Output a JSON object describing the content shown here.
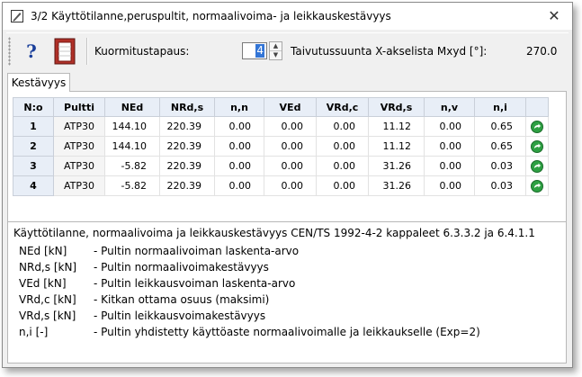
{
  "window": {
    "title": "3/2  Käyttötilanne,peruspultit, normaalivoima- ja leikkauskestävyys",
    "close_glyph": "✕"
  },
  "toolbar": {
    "help_label": "?",
    "load_case_label": "Kuormitustapaus:",
    "load_case_value": "4",
    "bending_label": "Taivutussuunta X-akselista Mxyd [°]:",
    "bending_value": "270.0"
  },
  "tabs": [
    {
      "label": "Kestävyys"
    }
  ],
  "table": {
    "columns": [
      "N:o",
      "Pultti",
      "NEd",
      "NRd,s",
      "n,n",
      "VEd",
      "VRd,c",
      "VRd,s",
      "n,v",
      "n,i",
      ""
    ],
    "rows": [
      [
        "1",
        "ATP30",
        "144.10",
        "220.39",
        "0.00",
        "0.00",
        "0.00",
        "11.12",
        "0.00",
        "0.65"
      ],
      [
        "2",
        "ATP30",
        "144.10",
        "220.39",
        "0.00",
        "0.00",
        "0.00",
        "11.12",
        "0.00",
        "0.65"
      ],
      [
        "3",
        "ATP30",
        "-5.82",
        "220.39",
        "0.00",
        "0.00",
        "0.00",
        "31.26",
        "0.00",
        "0.03"
      ],
      [
        "4",
        "ATP30",
        "-5.82",
        "220.39",
        "0.00",
        "0.00",
        "0.00",
        "31.26",
        "0.00",
        "0.03"
      ]
    ]
  },
  "info": {
    "title": "Käyttötilanne, normaalivoima ja leikkauskestävyys CEN/TS 1992-4-2 kappaleet 6.3.3.2 ja 6.4.1.1",
    "legend": [
      {
        "symbol": "NEd [kN]",
        "desc": "- Pultin normaalivoiman laskenta-arvo"
      },
      {
        "symbol": "NRd,s [kN]",
        "desc": "- Pultin normaalivoimakestävyys"
      },
      {
        "symbol": "VEd [kN]",
        "desc": "- Pultin leikkausvoiman laskenta-arvo"
      },
      {
        "symbol": "VRd,c [kN]",
        "desc": "- Kitkan ottama osuus (maksimi)"
      },
      {
        "symbol": "VRd,s [kN]",
        "desc": "- Pultin leikkausvoimakestävyys"
      },
      {
        "symbol": "n,i [-]",
        "desc": "- Pultin yhdistetty käyttöaste normaalivoimalle ja leikkaukselle (Exp=2)"
      }
    ]
  },
  "colors": {
    "header_bg": "#e8eef7",
    "ok_icon": "#2ea043",
    "selection": "#3375d6"
  },
  "icons": {
    "title": "pencil-icon",
    "help": "help-icon",
    "door": "door-icon",
    "row_action": "green-arrow-icon"
  }
}
